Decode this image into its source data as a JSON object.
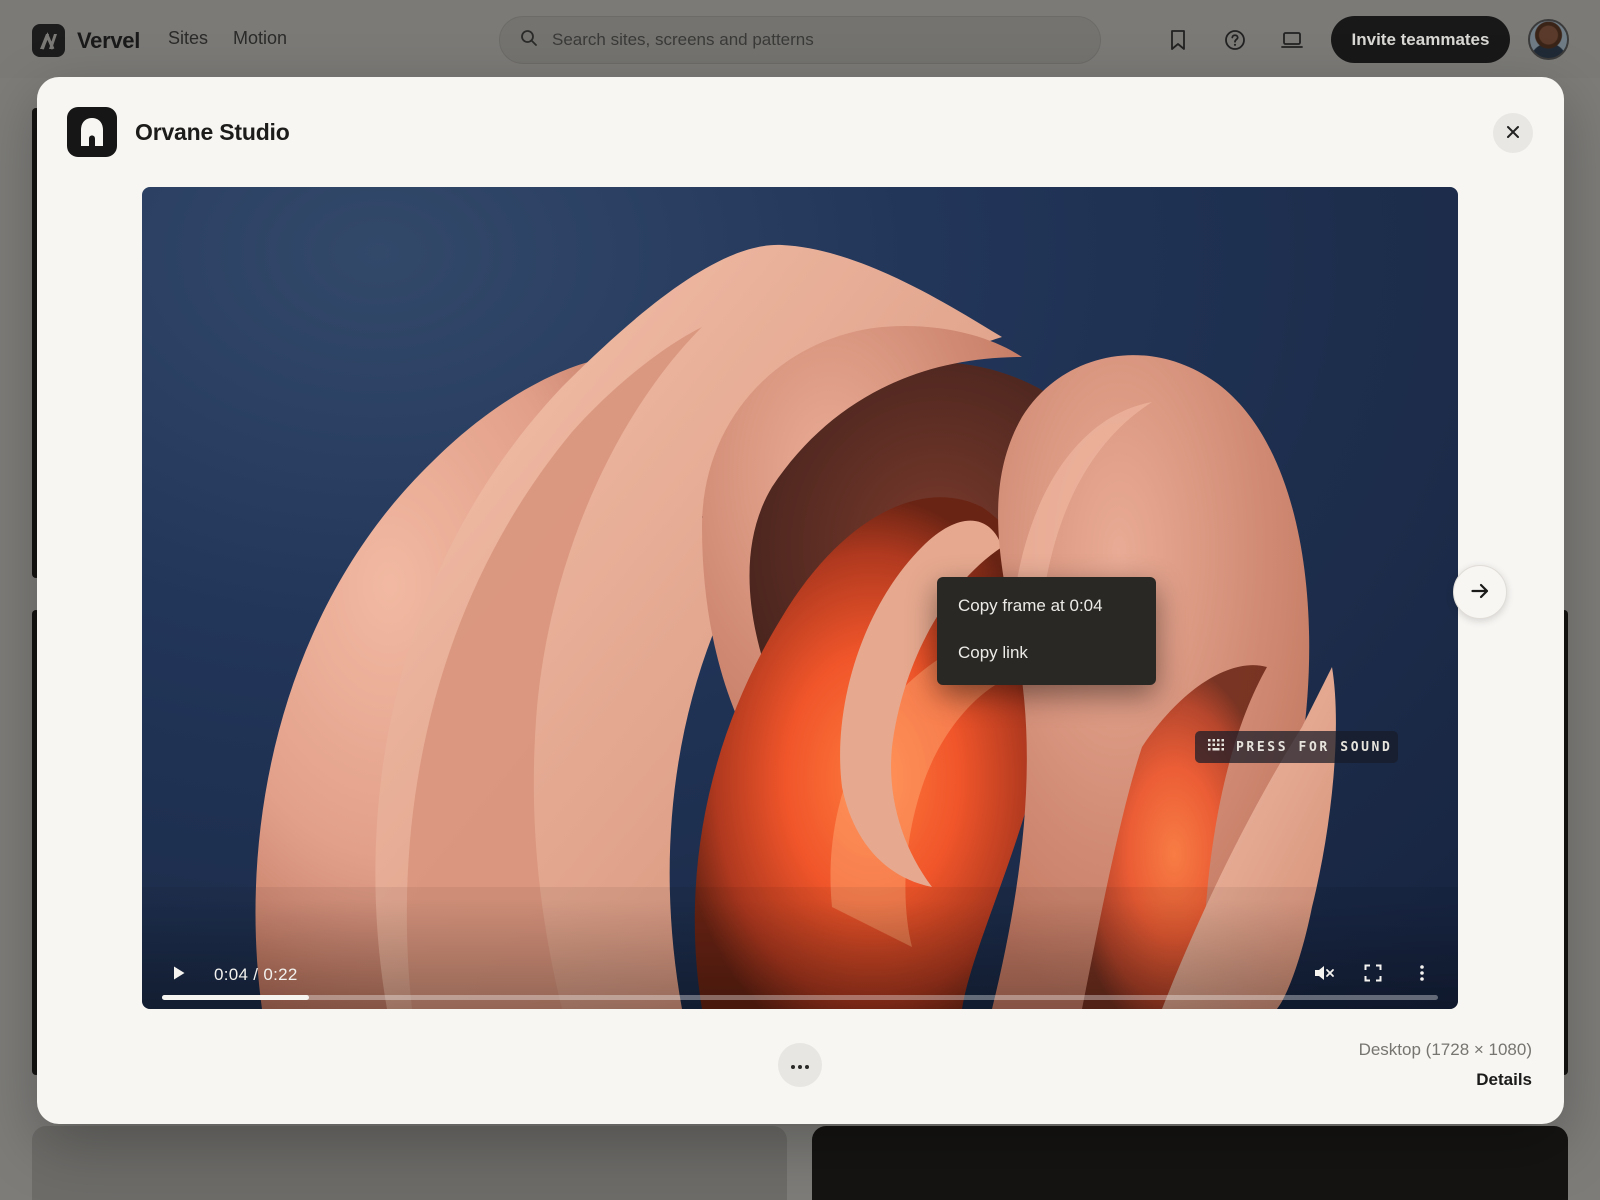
{
  "app": {
    "brand_name": "Vervel",
    "brand_icon": "vervel-logo-icon"
  },
  "nav": {
    "items": [
      {
        "label": "Sites"
      },
      {
        "label": "Motion"
      }
    ]
  },
  "search": {
    "placeholder": "Search sites, screens and patterns",
    "icon": "search-icon"
  },
  "toolbar": {
    "icons": [
      "bookmark-icon",
      "help-icon",
      "device-icon"
    ],
    "invite_label": "Invite teammates"
  },
  "modal": {
    "title": "Orvane Studio",
    "logo_icon": "studio-arch-logo-icon",
    "close_icon": "close-icon",
    "next_icon": "arrow-right-icon",
    "more_icon": "more-horizontal-icon",
    "dimensions_label": "Desktop (1728 × 1080)",
    "details_label": "Details"
  },
  "video": {
    "time": "0:04 / 0:22",
    "progress": 0.115,
    "muted": true,
    "context_menu": [
      {
        "label": "Copy frame at 0:04"
      },
      {
        "label": "Copy link"
      }
    ],
    "sound_prompt": "PRESS FOR SOUND"
  },
  "colors": {
    "accent_dark": "#181818",
    "modal_bg": "#f8f6f3",
    "video_bg": "#1c2c4a",
    "sculpture_peach": "#e7a48c",
    "sculpture_glow": "#f0552a"
  }
}
